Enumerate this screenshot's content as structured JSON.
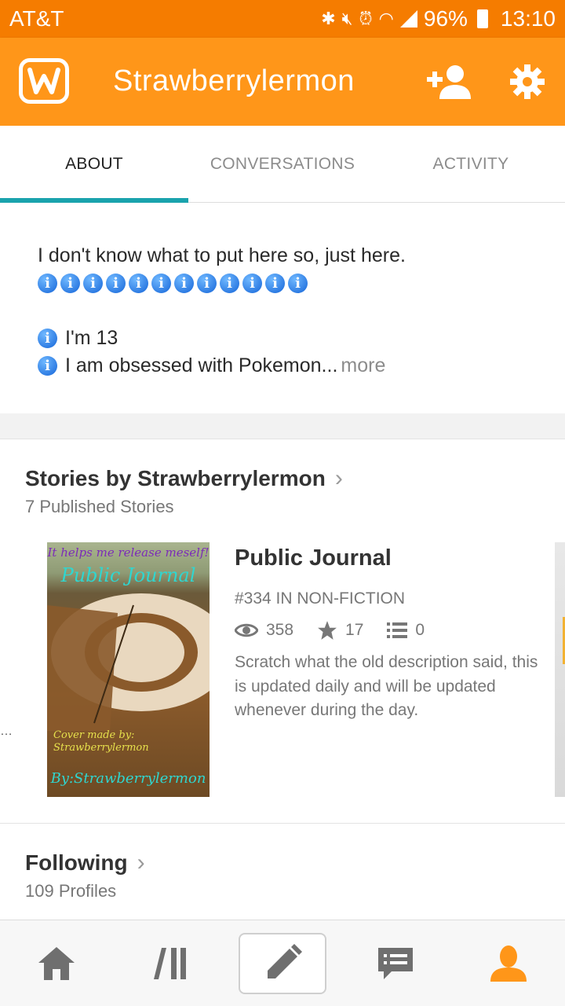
{
  "status_bar": {
    "carrier": "AT&T",
    "battery": "96%",
    "time": "13:10",
    "icons": [
      "bluetooth-icon",
      "mute-icon",
      "alarm-icon",
      "wifi-icon",
      "signal-icon",
      "battery-icon"
    ]
  },
  "app_bar": {
    "title": "Strawberrylermon",
    "logo_icon": "wattpad-logo-icon",
    "follow_icon": "add-person-icon",
    "settings_icon": "gear-icon"
  },
  "tabs": [
    {
      "label": "ABOUT",
      "active": true
    },
    {
      "label": "CONVERSATIONS",
      "active": false
    },
    {
      "label": "ACTIVITY",
      "active": false
    }
  ],
  "about": {
    "line1": "I don't know what to put here so, just here.",
    "emoji_row_count": 12,
    "item1": "I'm 13",
    "item2": "I am obsessed with Pokemon...",
    "more": "more"
  },
  "stories": {
    "title": "Stories by Strawberrylermon",
    "count_label": "7 Published Stories",
    "story": {
      "title": "Public Journal",
      "rank": "#334 IN NON-FICTION",
      "reads": "358",
      "votes": "17",
      "parts": "0",
      "description": "Scratch what the old description said, this is updated daily and will be updated whenever during the day.",
      "cover": {
        "tagline": "It helps me release meself!",
        "title": "Public Journal",
        "made_by": "Cover made by: Strawberrylermon",
        "by": "By:Strawberrylermon"
      }
    }
  },
  "following": {
    "title": "Following",
    "count_label": "109 Profiles"
  },
  "bottom_nav": {
    "items": [
      "home-icon",
      "library-icon",
      "write-icon",
      "messages-icon",
      "profile-icon"
    ]
  },
  "colors": {
    "status_bar": "#f57c00",
    "app_bar": "#ff9619",
    "tab_indicator": "#1aa3ad",
    "active_nav": "#ff9619",
    "inactive_nav": "#6f6f6f"
  }
}
